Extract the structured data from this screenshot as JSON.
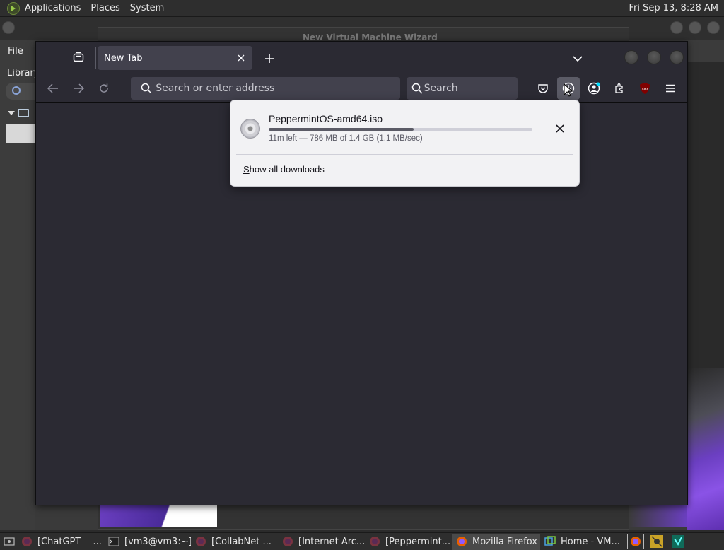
{
  "top_panel": {
    "menus": [
      "Applications",
      "Places",
      "System"
    ],
    "clock": "Fri Sep 13,  8:28 AM"
  },
  "background": {
    "dialog_title": "New Virtual Machine Wizard",
    "menu_file": "File",
    "sidebar_label": "Library"
  },
  "firefox": {
    "tab": {
      "title": "New Tab"
    },
    "urlbar": {
      "placeholder": "Search or enter address"
    },
    "searchbar": {
      "placeholder": "Search"
    },
    "toolbar_icons": [
      "pocket-icon",
      "downloads-icon",
      "account-icon",
      "extensions-icon",
      "ublock-icon",
      "menu-icon"
    ],
    "ublock_label": "uo"
  },
  "downloads_panel": {
    "filename": "PeppermintOS-amd64.iso",
    "status": "11m left — 786 MB of 1.4 GB (1.1 MB/sec)",
    "progress_fraction": 0.55,
    "show_all_prefix": "S",
    "show_all_rest": "how all downloads"
  },
  "taskbar": {
    "tasks": [
      {
        "label": "[ChatGPT —...",
        "icon": "firefox-icon",
        "active": false
      },
      {
        "label": "[vm3@vm3:~]",
        "icon": "terminal-icon",
        "active": false
      },
      {
        "label": "[CollabNet ...",
        "icon": "firefox-icon",
        "active": false
      },
      {
        "label": "[Internet Arc...",
        "icon": "firefox-icon",
        "active": false
      },
      {
        "label": "[Peppermint...",
        "icon": "firefox-icon",
        "active": false
      },
      {
        "label": "Mozilla Firefox",
        "icon": "firefox-icon",
        "active": true
      },
      {
        "label": "Home - VM...",
        "icon": "vmware-icon",
        "active": false
      }
    ]
  },
  "colors": {
    "firefox_chrome": "#2b2a33",
    "panel_bg": "#f2f2f4",
    "progress_fill": "#5b5b66",
    "ublock_red": "#800000"
  }
}
